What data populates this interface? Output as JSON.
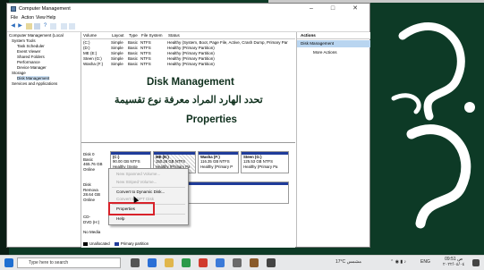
{
  "window": {
    "title": "Computer Management",
    "controls": {
      "minimize": "–",
      "maximize": "□",
      "close": "✕"
    },
    "menu": [
      "File",
      "Action",
      "View",
      "Help"
    ]
  },
  "tree": {
    "items": [
      "Computer Management (Local",
      "System Tools",
      "Task Scheduler",
      "Event Viewer",
      "Shared Folders",
      "Performance",
      "Device Manager",
      "Storage",
      "Disk Management",
      "Services and Applications"
    ]
  },
  "volume_list": {
    "columns": [
      "Volume",
      "Layout",
      "Type",
      "File System",
      "Status"
    ],
    "rows": [
      [
        "(C:)",
        "Simple",
        "Basic",
        "NTFS",
        "Healthy (System, Boot, Page File, Active, Crash Dump, Primary Par"
      ],
      [
        "(D:)",
        "Simple",
        "Basic",
        "NTFS",
        "Healthy (Primary Partition)"
      ],
      [
        "ME (E:)",
        "Simple",
        "Basic",
        "NTFS",
        "Healthy (Primary Partition)"
      ],
      [
        "Steen (G:)",
        "Simple",
        "Basic",
        "NTFS",
        "Healthy (Primary Partition)"
      ],
      [
        "Washa (F:)",
        "Simple",
        "Basic",
        "NTFS",
        "Healthy (Primary Partition)"
      ]
    ]
  },
  "overlay": {
    "english_title": "Disk Management",
    "arabic_title": "تحدد الهارد المراد معرفة نوع تقسيمة",
    "properties": "Properties"
  },
  "disks": {
    "disk0_label": "Disk 0\nBasic\n465.76 GB\nOnline",
    "partitions": [
      {
        "name": "(C:)",
        "size": "90.00 GB NTFS",
        "status": "Healthy (Syste"
      },
      {
        "name": "ME (E:)",
        "size": "150.28 GB NTFS",
        "status": "Healthy (Primary Pa"
      },
      {
        "name": "Washa (F:)",
        "size": "116.35 GB NTFS",
        "status": "Healthy (Primary P"
      },
      {
        "name": "Steen (G:)",
        "size": "125.53 GB NTFS",
        "status": "Healthy (Primary Pa"
      }
    ],
    "disk1_label": "Disk\nRemova\n28.64 GB\nOnline",
    "cdrom_label": "CD-\nDVD (H:)\n\nNo Media",
    "legend": {
      "unallocated": "Unallocated",
      "primary": "Primary partition"
    }
  },
  "context_menu": {
    "items": [
      {
        "label": "New Spanned Volume...",
        "disabled": true
      },
      {
        "label": "New Striped Volume...",
        "disabled": true
      },
      {
        "label": "Convert to Dynamic Disk...",
        "disabled": false
      },
      {
        "label": "Convert to GPT Disk",
        "disabled": true
      },
      {
        "label": "Properties",
        "disabled": false
      },
      {
        "label": "Help",
        "disabled": false
      }
    ]
  },
  "actions": {
    "header": "Actions",
    "selected": "Disk Management",
    "more": "More Actions"
  },
  "taskbar": {
    "search_placeholder": "Type here to search",
    "weather": "17°C",
    "weather_desc": "مشمس",
    "lang": "ENG",
    "time": "09:51 ص",
    "date": "٢٠٢٢/٠٤/٠٤"
  },
  "colors": {
    "accent_partition": "#1f3c9a",
    "highlight_box": "#d8222a",
    "desktop": "#0d3a26"
  }
}
